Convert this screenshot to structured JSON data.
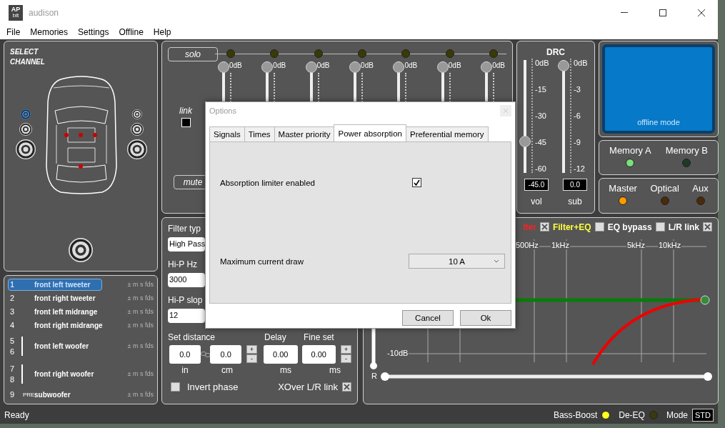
{
  "window": {
    "logo": {
      "text": "AP",
      "sub": "bit"
    },
    "title": "audison"
  },
  "menu": [
    "File",
    "Memories",
    "Settings",
    "Offline",
    "Help"
  ],
  "select_channel": {
    "title": "SELECT CHANNEL"
  },
  "speakers": {
    "left": [
      {
        "kind": "tweeter",
        "selected": true
      },
      {
        "kind": "midrange",
        "selected": false
      },
      {
        "kind": "woofer",
        "selected": false
      }
    ],
    "right": [
      {
        "kind": "tweeter",
        "selected": false
      },
      {
        "kind": "midrange",
        "selected": false
      },
      {
        "kind": "woofer",
        "selected": false
      }
    ],
    "sub": {
      "kind": "sub",
      "selected": false
    }
  },
  "channels": [
    {
      "numbers": [
        "1"
      ],
      "name": "front left tweeter",
      "flags": "± m s fds",
      "selected": true
    },
    {
      "numbers": [
        "2"
      ],
      "name": "front right tweeter",
      "flags": "± m s fds",
      "selected": false
    },
    {
      "numbers": [
        "3"
      ],
      "name": "front left midrange",
      "flags": "± m s fds",
      "selected": false
    },
    {
      "numbers": [
        "4"
      ],
      "name": "front right midrange",
      "flags": "± m s fds",
      "selected": false
    },
    {
      "numbers": [
        "5",
        "6"
      ],
      "name": "front left woofer",
      "flags": "± m s fds",
      "selected": false
    },
    {
      "numbers": [
        "7",
        "8"
      ],
      "name": "front right woofer",
      "flags": "± m s fds",
      "selected": false
    },
    {
      "numbers": [
        "9"
      ],
      "tag": "PRE",
      "name": "subwoofer",
      "flags": "± m s fds",
      "selected": false
    }
  ],
  "mixer": {
    "solo": "solo",
    "mute": "mute",
    "link": {
      "label": "link",
      "checked": false
    },
    "strips": [
      {
        "label": "0dB",
        "level": 1,
        "solo_on": false
      },
      {
        "label": "0dB",
        "level": 1,
        "solo_on": false
      },
      {
        "label": "0dB",
        "level": 1,
        "solo_on": false
      },
      {
        "label": "0dB",
        "level": 1,
        "solo_on": false
      },
      {
        "label": "0dB",
        "level": 1,
        "solo_on": false
      },
      {
        "label": "0dB",
        "level": 1,
        "solo_on": false
      },
      {
        "label": "0dB",
        "level": 1,
        "solo_on": false
      }
    ]
  },
  "drc": {
    "title": "DRC",
    "sliders": [
      {
        "name": "vol",
        "scale": [
          "0dB",
          "-15",
          "-30",
          "-45",
          "-60"
        ],
        "level": 0.25,
        "value": "-45.0"
      },
      {
        "name": "sub",
        "scale": [
          "0dB",
          "-3",
          "-6",
          "-9",
          "-12"
        ],
        "level": 1,
        "value": "0.0"
      }
    ]
  },
  "display": {
    "text": "offline mode"
  },
  "memories": [
    {
      "label": "Memory A",
      "on": true
    },
    {
      "label": "Memory B",
      "on": false
    }
  ],
  "sources": [
    {
      "label": "Master",
      "on": true
    },
    {
      "label": "Optical",
      "on": false
    },
    {
      "label": "Aux",
      "on": false
    }
  ],
  "filter": {
    "type_label": "Filter typ",
    "type_value": "High Pass",
    "hz_label": "Hi-P Hz",
    "hz_value": "3000",
    "slope_label": "Hi-P slop",
    "slope_value": "12",
    "distance_label": "Set distance",
    "delay_label": "Delay",
    "fine_label": "Fine set",
    "distance_in": {
      "value": "0.0",
      "unit": "in"
    },
    "distance_cm": {
      "value": "0.0",
      "unit": "cm"
    },
    "delay": {
      "value": "0.00",
      "unit": "ms"
    },
    "fine": {
      "value": "0.00",
      "unit": "ms"
    },
    "steppers": [
      [
        "+",
        "-"
      ],
      [
        "+",
        "-"
      ]
    ],
    "invert_phase": {
      "label": "Invert phase",
      "checked": false
    },
    "xover_link": {
      "label": "XOver L/R link",
      "checked": true
    }
  },
  "graph": {
    "legend": [
      {
        "label": "lter",
        "color": "#ff2020",
        "checked": true
      },
      {
        "label": "Filter+EQ",
        "color": "#ffff40",
        "checked": false
      },
      {
        "label": "EQ bypass",
        "color": "#ffffff",
        "checked": false
      },
      {
        "label": "L/R link",
        "color": "#ffffff",
        "checked": true
      }
    ],
    "freq_labels": [
      "500Hz",
      "1kHz",
      "5kHz",
      "10kHz"
    ],
    "db_label": "-10dB",
    "channel_label": "R"
  },
  "status": {
    "text": "Ready",
    "indicators": [
      {
        "label": "Bass-Boost",
        "on": true
      },
      {
        "label": "De-EQ",
        "on": false
      }
    ],
    "mode_label": "Mode",
    "mode_value": "STD"
  },
  "dialog": {
    "title": "Options",
    "tabs": [
      {
        "label": "Signals",
        "selected": false
      },
      {
        "label": "Times",
        "selected": false
      },
      {
        "label": "Master priority",
        "selected": false
      },
      {
        "label": "Power absorption",
        "selected": true
      },
      {
        "label": "Preferential memory",
        "selected": false
      }
    ],
    "limiter": {
      "label": "Absorption limiter enabled",
      "checked": true
    },
    "current": {
      "label": "Maximum current draw",
      "value": "10 A"
    },
    "buttons": [
      "Cancel",
      "Ok"
    ]
  }
}
